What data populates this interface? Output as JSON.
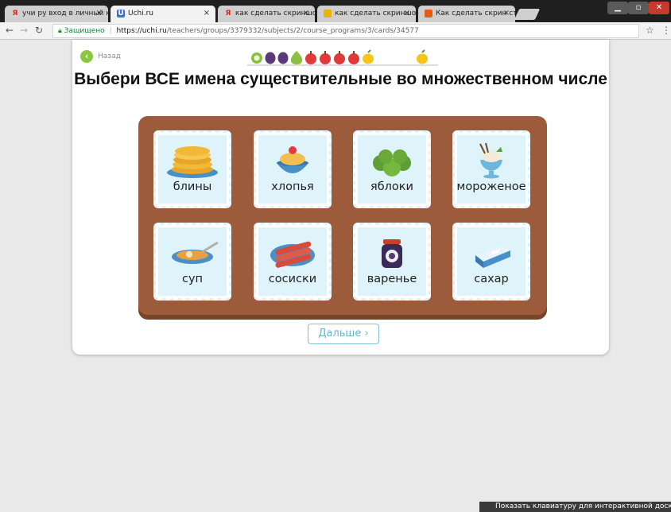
{
  "browser": {
    "tabs": [
      {
        "label": "учи ру вход в личный к",
        "favicon": "yandex-icon"
      },
      {
        "label": "Uchi.ru",
        "favicon": "uchi-icon",
        "active": true
      },
      {
        "label": "как сделать скриншот с",
        "favicon": "yandex-icon"
      },
      {
        "label": "как сделать скриншот с",
        "favicon": "screenshot-icon"
      },
      {
        "label": "Как сделать скрин стра",
        "favicon": "page-icon"
      }
    ],
    "close_glyph": "×",
    "address": {
      "secure_label": "Защищено",
      "url_host": "https://uchi.ru",
      "url_path": "/teachers/groups/3379332/subjects/2/course_programs/3/cards/34577"
    }
  },
  "page": {
    "back_label": "Назад",
    "title": "Выбери ВСЕ имена существительные во множественном числе",
    "cards": [
      {
        "label": "блины",
        "icon": "pancakes-icon"
      },
      {
        "label": "хлопья",
        "icon": "cereal-icon"
      },
      {
        "label": "яблоки",
        "icon": "apples-icon"
      },
      {
        "label": "мороженое",
        "icon": "ice-cream-icon"
      },
      {
        "label": "суп",
        "icon": "soup-icon"
      },
      {
        "label": "сосиски",
        "icon": "sausages-icon"
      },
      {
        "label": "варенье",
        "icon": "jam-icon"
      },
      {
        "label": "сахар",
        "icon": "sugar-icon"
      }
    ],
    "next_label": "Дальше ›"
  },
  "keyboard_bar": "Показать клавиатуру для интерактивной доски",
  "colors": {
    "accent_green": "#8cc63f",
    "table_wood": "#9c5b3a",
    "card_bg": "#dff3fa",
    "next_border": "#7fc4d8"
  }
}
